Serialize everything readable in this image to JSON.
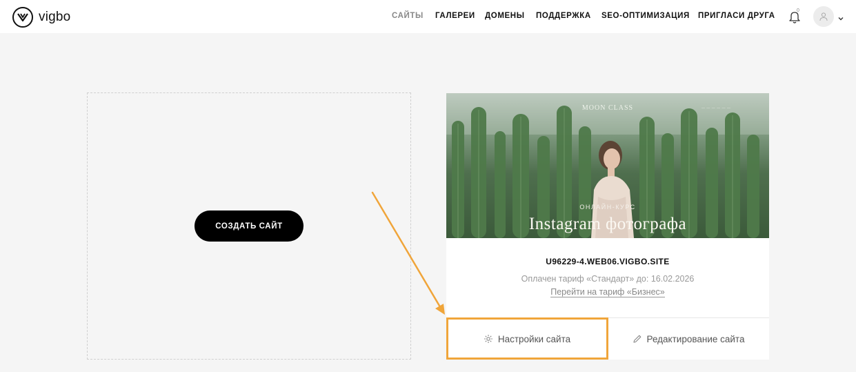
{
  "brand": {
    "name": "vigbo"
  },
  "nav": {
    "items": [
      {
        "label": "САЙТЫ",
        "active": true
      },
      {
        "label": "ГАЛЕРЕИ"
      },
      {
        "label": "ДОМЕНЫ"
      },
      {
        "label": "ПОДДЕРЖКА"
      },
      {
        "label": "SEO-ОПТИМИЗАЦИЯ"
      },
      {
        "label": "ПРИГЛАСИ ДРУГА"
      }
    ],
    "notifications_count": "0"
  },
  "create": {
    "button_label": "СОЗДАТЬ САЙТ"
  },
  "site": {
    "preview": {
      "brand": "MOON CLASS",
      "subtitle": "ОНЛАЙН-КУРС",
      "title": "Instagram фотографа"
    },
    "domain": "U96229-4.WEB06.VIGBO.SITE",
    "tariff": "Оплачен тариф «Стандарт» до: 16.02.2026",
    "upgrade_link": "Перейти на тариф «Бизнес»",
    "settings_label": "Настройки сайта",
    "edit_label": "Редактирование сайта"
  },
  "colors": {
    "accent_highlight": "#f0a53a",
    "primary_button": "#000000",
    "background": "#f5f5f5"
  }
}
